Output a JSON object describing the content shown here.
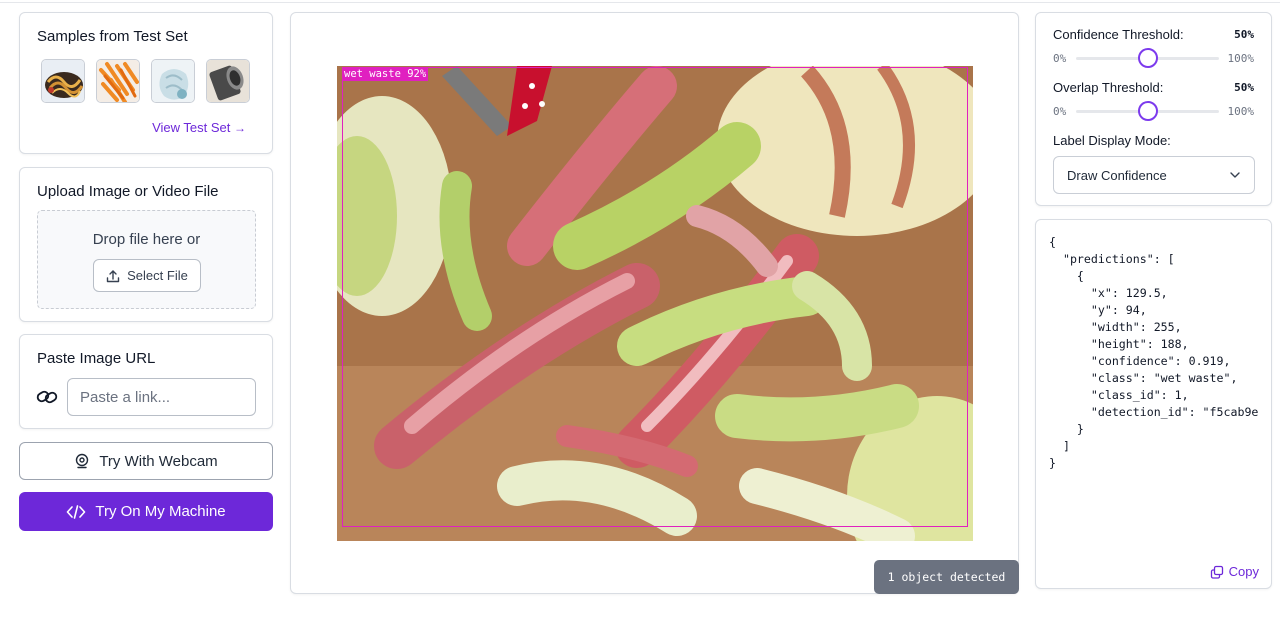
{
  "samples": {
    "title": "Samples from Test Set",
    "link": "View Test Set",
    "thumbnails": [
      "noodles-sample",
      "carrot-peel-sample",
      "plastic-bag-sample",
      "metal-can-sample"
    ]
  },
  "upload": {
    "title": "Upload Image or Video File",
    "drop_text": "Drop file here or",
    "select_label": "Select File"
  },
  "url": {
    "title": "Paste Image URL",
    "placeholder": "Paste a link..."
  },
  "buttons": {
    "webcam": "Try With Webcam",
    "machine": "Try On My Machine"
  },
  "viewer": {
    "box_label": "wet waste 92%",
    "status": "1 object detected"
  },
  "settings": {
    "confidence_label": "Confidence Threshold:",
    "confidence_value": "50%",
    "confidence_fraction": 0.5,
    "overlap_label": "Overlap Threshold:",
    "overlap_value": "50%",
    "overlap_fraction": 0.5,
    "min": "0%",
    "max": "100%",
    "mode_label": "Label Display Mode:",
    "mode_value": "Draw Confidence"
  },
  "json_output": {
    "lines": [
      "{",
      "  \"predictions\": [",
      "    {",
      "      \"x\": 129.5,",
      "      \"y\": 94,",
      "      \"width\": 255,",
      "      \"height\": 188,",
      "      \"confidence\": 0.919,",
      "      \"class\": \"wet waste\",",
      "      \"class_id\": 1,",
      "      \"detection_id\": \"f5cab9e",
      "    }",
      "  ]",
      "}"
    ],
    "copy_label": "Copy"
  },
  "colors": {
    "accent": "#6d28d9",
    "bbox": "#e020c0"
  }
}
